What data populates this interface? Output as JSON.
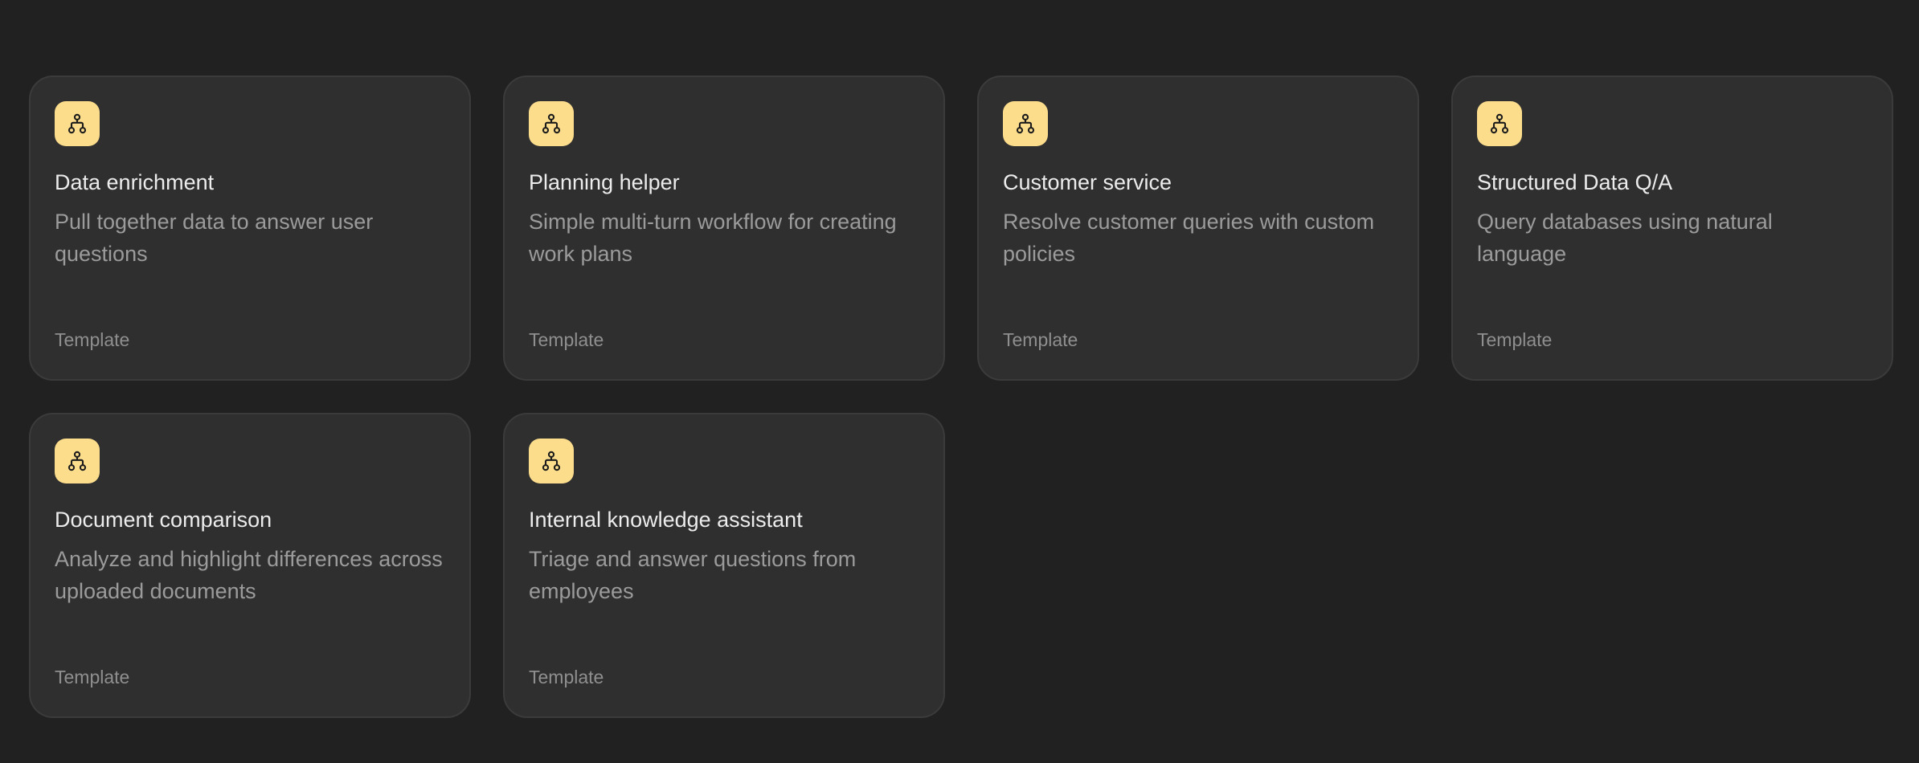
{
  "colors": {
    "background": "#212121",
    "card_background": "#2f2f2f",
    "card_border": "#3b3b3b",
    "icon_background": "#fcdd8c",
    "title_text": "#ececec",
    "description_text": "#9b9b9b"
  },
  "cards": [
    {
      "icon": "workflow-icon",
      "title": "Data enrichment",
      "description": "Pull together data to answer user questions",
      "tag": "Template"
    },
    {
      "icon": "workflow-icon",
      "title": "Planning helper",
      "description": "Simple multi-turn workflow for creating work plans",
      "tag": "Template"
    },
    {
      "icon": "workflow-icon",
      "title": "Customer service",
      "description": "Resolve customer queries with custom policies",
      "tag": "Template"
    },
    {
      "icon": "workflow-icon",
      "title": "Structured Data Q/A",
      "description": "Query databases using natural language",
      "tag": "Template"
    },
    {
      "icon": "workflow-icon",
      "title": "Document comparison",
      "description": "Analyze and highlight differences across uploaded documents",
      "tag": "Template"
    },
    {
      "icon": "workflow-icon",
      "title": "Internal knowledge assistant",
      "description": "Triage and answer questions from employees",
      "tag": "Template"
    }
  ]
}
